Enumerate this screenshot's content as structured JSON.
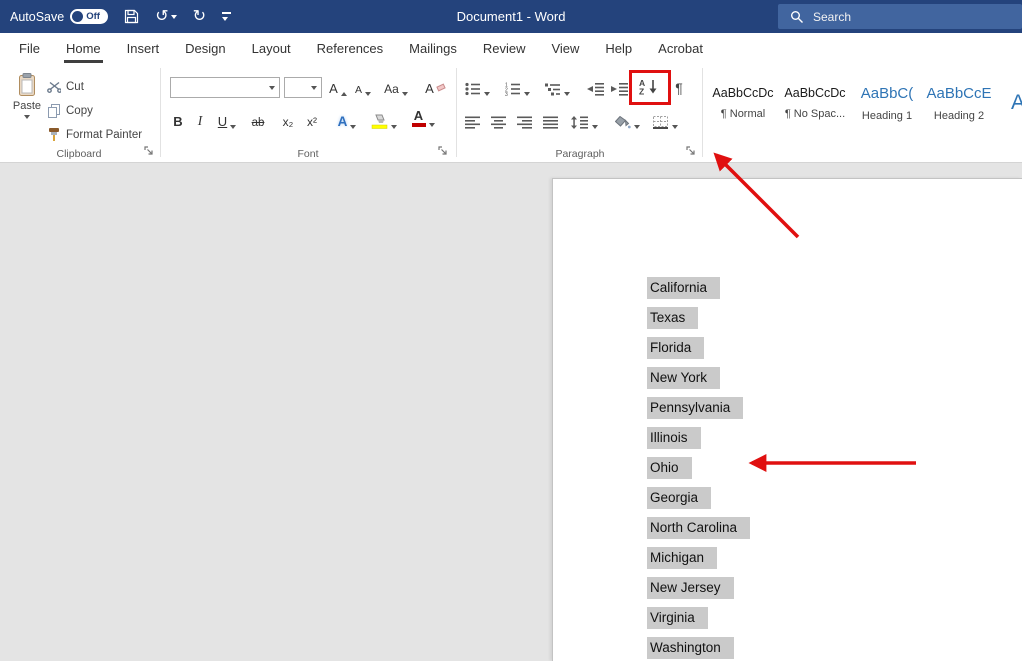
{
  "titlebar": {
    "autosave_label": "AutoSave",
    "autosave_state": "Off",
    "title": "Document1  -  Word",
    "search_placeholder": "Search"
  },
  "tabs": {
    "items": [
      {
        "label": "File"
      },
      {
        "label": "Home"
      },
      {
        "label": "Insert"
      },
      {
        "label": "Design"
      },
      {
        "label": "Layout"
      },
      {
        "label": "References"
      },
      {
        "label": "Mailings"
      },
      {
        "label": "Review"
      },
      {
        "label": "View"
      },
      {
        "label": "Help"
      },
      {
        "label": "Acrobat"
      }
    ],
    "active": "Home"
  },
  "ribbon": {
    "clipboard": {
      "label": "Clipboard",
      "paste": "Paste",
      "cut": "Cut",
      "copy": "Copy",
      "format_painter": "Format Painter"
    },
    "font": {
      "label": "Font",
      "font_name_value": "",
      "font_size_value": "",
      "increase": "A",
      "decrease": "A",
      "change_case": "Aa",
      "clear": "A",
      "bold": "B",
      "italic": "I",
      "underline": "U",
      "strikethrough": "ab",
      "subscript": "x₂",
      "superscript": "x²",
      "text_effects": "A",
      "font_color": "A"
    },
    "paragraph": {
      "label": "Paragraph",
      "sort_a": "A",
      "sort_z": "Z",
      "pilcrow": "¶"
    },
    "styles": {
      "items": [
        {
          "preview": "AaBbCcDc",
          "label": "¶ Normal"
        },
        {
          "preview": "AaBbCcDc",
          "label": "¶ No Spac..."
        },
        {
          "preview": "AaBbC(",
          "label": "Heading 1"
        },
        {
          "preview": "AaBbCcE",
          "label": "Heading 2"
        },
        {
          "preview": "A",
          "label": ""
        }
      ]
    }
  },
  "document": {
    "lines": [
      "California",
      "Texas",
      "Florida",
      "New York",
      "Pennsylvania",
      "Illinois",
      "Ohio",
      "Georgia",
      "North Carolina",
      "Michigan",
      "New Jersey",
      "Virginia",
      "Washington"
    ]
  },
  "colors": {
    "titlebar_bg": "#24437c",
    "search_bg": "#41659f",
    "accent_red": "#e01010",
    "selection_gray": "#cacaca",
    "heading_blue": "#2e74b5",
    "doc_bg": "#e4e4e4"
  }
}
